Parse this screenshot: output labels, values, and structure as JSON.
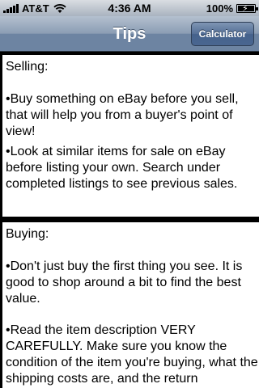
{
  "status_bar": {
    "carrier": "AT&T",
    "time": "4:36 AM",
    "battery_text": "100%",
    "icons": [
      "signal-icon",
      "wifi-icon",
      "battery-icon"
    ]
  },
  "nav": {
    "title": "Tips",
    "right_button": "Calculator"
  },
  "sections": {
    "selling": {
      "heading": "Selling:",
      "tips": [
        "•Buy something on eBay before you sell, that will help you from a buyer's point of view!",
        "•Look at similar items for sale on eBay before listing your own.  Search under completed listings to see previous sales."
      ]
    },
    "buying": {
      "heading": "Buying:",
      "tips": [
        "•Don't just buy the first thing you see.  It is good to shop around a bit to find the best value.",
        "•Read the item description VERY CAREFULLY.  Make sure you know the condition of the item you're buying, what the shipping costs are, and the return"
      ]
    }
  }
}
